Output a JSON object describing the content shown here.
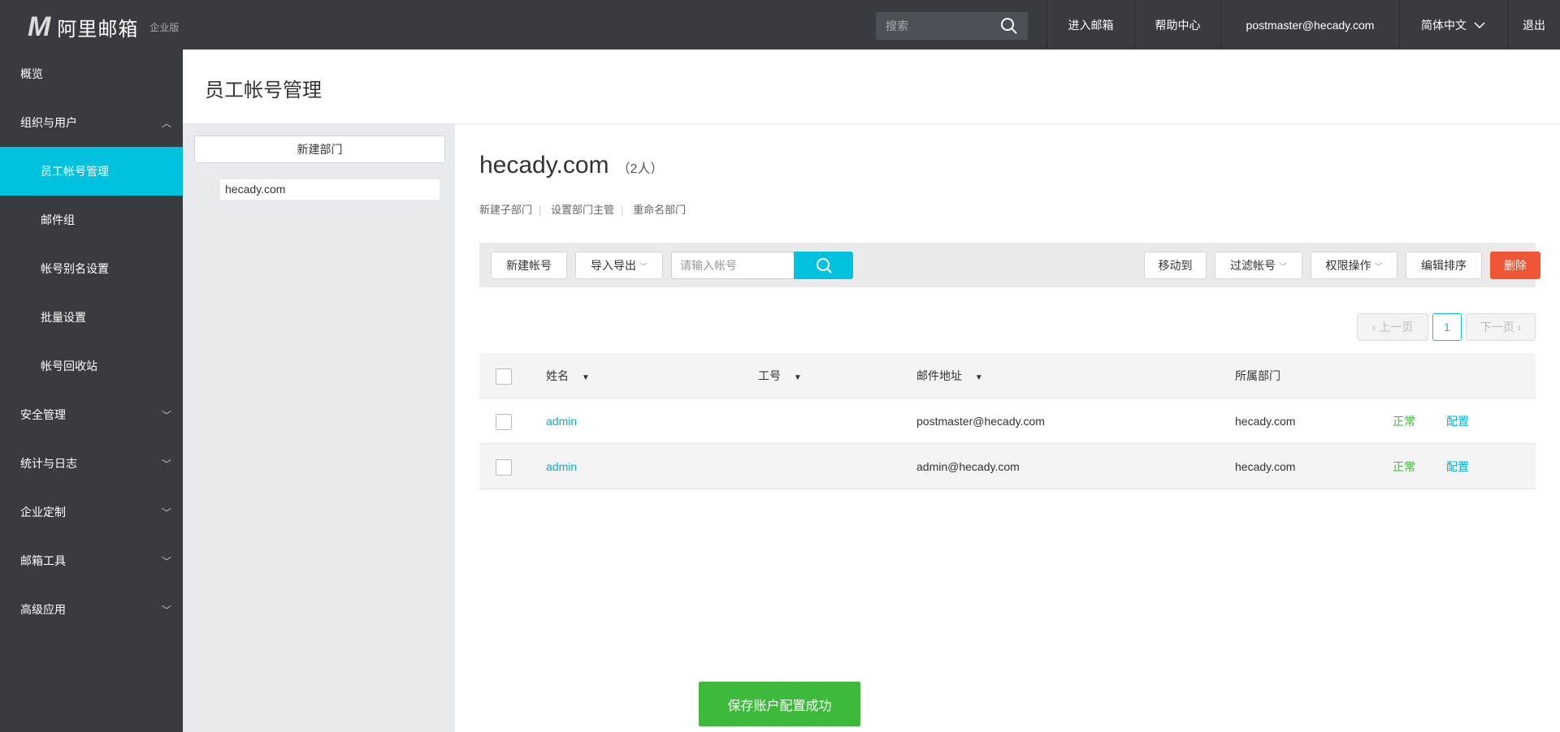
{
  "topbar": {
    "logo_mark": "M",
    "logo_text": "阿里邮箱",
    "edition": "企业版",
    "search_placeholder": "搜索",
    "nav": [
      "进入邮箱",
      "帮助中心",
      "postmaster@hecady.com",
      "简体中文",
      "退出"
    ]
  },
  "sidebar": {
    "items": [
      {
        "label": "概览",
        "chevron": ""
      },
      {
        "label": "组织与用户",
        "chevron": "^"
      },
      {
        "label": "员工帐号管理",
        "sub": true,
        "active": true
      },
      {
        "label": "邮件组",
        "sub": true
      },
      {
        "label": "帐号别名设置",
        "sub": true
      },
      {
        "label": "批量设置",
        "sub": true
      },
      {
        "label": "帐号回收站",
        "sub": true
      },
      {
        "label": "安全管理",
        "chevron": "v"
      },
      {
        "label": "统计与日志",
        "chevron": "v"
      },
      {
        "label": "企业定制",
        "chevron": "v"
      },
      {
        "label": "邮箱工具",
        "chevron": "v"
      },
      {
        "label": "高级应用",
        "chevron": "v"
      }
    ]
  },
  "page_title": "员工帐号管理",
  "dept": {
    "new_button": "新建部门",
    "tree": [
      "hecady.com"
    ]
  },
  "main": {
    "domain": "hecady.com",
    "count": "（2人）",
    "links": [
      "新建子部门",
      "设置部门主管",
      "重命名部门"
    ],
    "toolbar": {
      "new_account": "新建帐号",
      "import_export": "导入导出",
      "search_placeholder": "请输入帐号",
      "move_to": "移动到",
      "filter": "过滤帐号",
      "permission": "权限操作",
      "sort": "编辑排序",
      "delete": "删除"
    },
    "pagination": {
      "prev": "‹ 上一页",
      "current": "1",
      "next": "下一页 ›"
    },
    "table": {
      "headers": [
        "姓名",
        "工号",
        "邮件地址",
        "所属部门"
      ],
      "rows": [
        {
          "name": "admin",
          "id": "",
          "email": "postmaster@hecady.com",
          "dept": "hecady.com",
          "status": "正常",
          "action": "配置"
        },
        {
          "name": "admin",
          "id": "",
          "email": "admin@hecady.com",
          "dept": "hecady.com",
          "status": "正常",
          "action": "配置"
        }
      ]
    }
  },
  "toast": "保存账户配置成功",
  "colors": {
    "accent": "#00c1de",
    "danger": "#f05535",
    "success": "#3dba3c",
    "dark": "#383c41"
  }
}
